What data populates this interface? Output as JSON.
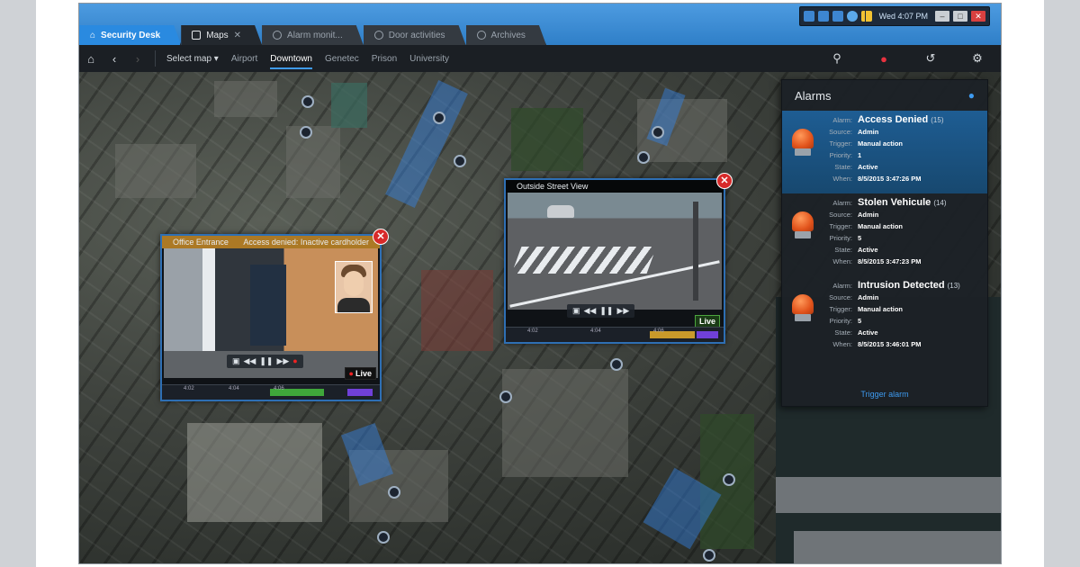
{
  "window": {
    "tray_time": "Wed 4:07 PM",
    "tabs": [
      {
        "label": "Security Desk"
      },
      {
        "label": "Maps"
      },
      {
        "label": "Alarm monit..."
      },
      {
        "label": "Door activities"
      },
      {
        "label": "Archives"
      }
    ]
  },
  "toolbar": {
    "select_map": "Select map ▾",
    "maps": [
      "Airport",
      "Downtown",
      "Genetec",
      "Prison",
      "University"
    ],
    "active_map": "Downtown"
  },
  "tiles": {
    "office": {
      "title": "Office Entrance",
      "subtitle": "Access denied: Inactive cardholder",
      "live": "Live"
    },
    "street": {
      "title": "Outside Street View",
      "live": "Live",
      "timestamps": [
        "4:02",
        "4:04",
        "4:06"
      ]
    },
    "office_timestamps": [
      "4:02",
      "4:04",
      "4:06"
    ]
  },
  "alarms": {
    "title": "Alarms",
    "labels": {
      "alarm": "Alarm:",
      "source": "Source:",
      "trigger": "Trigger:",
      "priority": "Priority:",
      "state": "State:",
      "when": "When:"
    },
    "items": [
      {
        "name": "Access Denied",
        "count": "(15)",
        "source": "Admin",
        "trigger": "Manual action",
        "priority": "1",
        "state": "Active",
        "when": "8/5/2015 3:47:26 PM"
      },
      {
        "name": "Stolen Vehicule",
        "count": "(14)",
        "source": "Admin",
        "trigger": "Manual action",
        "priority": "5",
        "state": "Active",
        "when": "8/5/2015 3:47:23 PM"
      },
      {
        "name": "Intrusion Detected",
        "count": "(13)",
        "source": "Admin",
        "trigger": "Manual action",
        "priority": "5",
        "state": "Active",
        "when": "8/5/2015 3:46:01 PM"
      }
    ],
    "trigger_link": "Trigger alarm"
  },
  "icons": {
    "home": "home-icon",
    "back": "back-icon",
    "forward": "forward-icon",
    "search": "search-icon",
    "alarm": "alarm-bell-icon",
    "refresh": "refresh-icon",
    "settings": "gear-icon"
  },
  "colors": {
    "accent": "#2a8ae0",
    "alarm": "#e8323f",
    "live": "#4ca53f"
  }
}
